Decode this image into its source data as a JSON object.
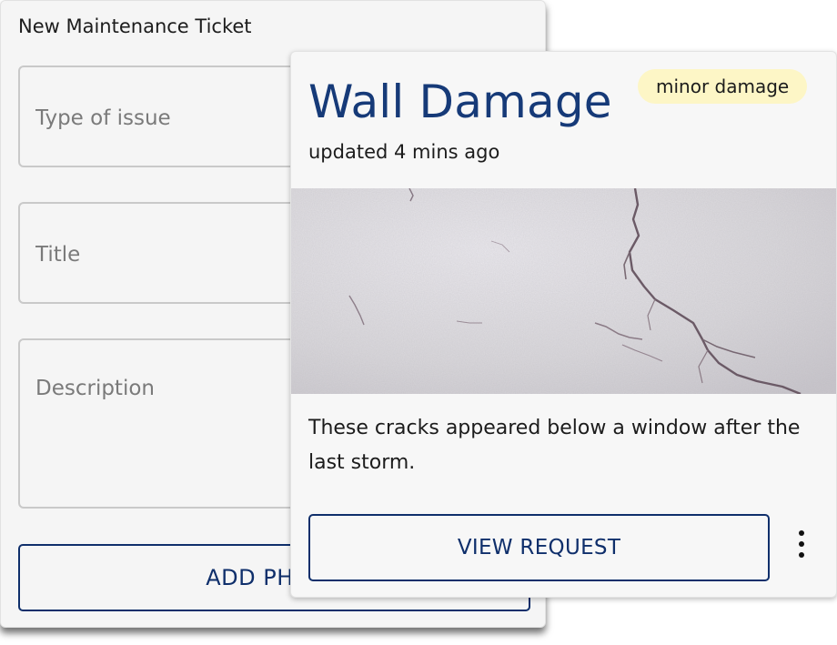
{
  "form": {
    "title": "New Maintenance Ticket",
    "type_placeholder": "Type of issue",
    "title_placeholder": "Title",
    "description_placeholder": "Description",
    "add_photo_label": "ADD PHOTO"
  },
  "ticket": {
    "title": "Wall Damage",
    "badge": "minor damage",
    "updated": "updated 4 mins ago",
    "photo_subject": "cracked-wall-photo",
    "description": "These cracks appeared below a window after the last storm.",
    "view_label": "VIEW REQUEST",
    "more_icon": "more-vertical-icon"
  },
  "colors": {
    "primary": "#163a78",
    "button_border": "#0f2f6b",
    "badge_bg": "#fdf6c6"
  }
}
